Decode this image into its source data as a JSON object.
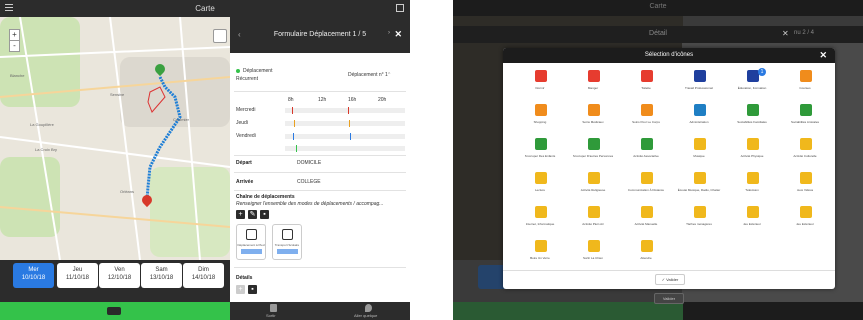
{
  "left": {
    "app_title": "Carte",
    "form": {
      "title": "Formulaire Déplacement 1 / 5",
      "move_label": "Déplacement",
      "recurrent_label": "Récurrent",
      "move_number": "Déplacement n° 1",
      "hours": [
        "8h",
        "12h",
        "16h",
        "20h"
      ],
      "weekdays": [
        "Mercredi",
        "Jeudi",
        "Vendredi"
      ],
      "depart_label": "Départ",
      "depart_value": "DOMICILE",
      "arrivee_label": "Arrivée",
      "arrivee_value": "COLLEGE",
      "chain_title": "Chaîne de déplacements",
      "chain_hint": "Renseigner l'ensemble des modes de déplacements / accompag...",
      "card1_caption": "Déplacement à Pied",
      "card2_caption": "Transport Scolaire",
      "details_label": "Détails"
    },
    "days": [
      {
        "name": "Mer",
        "date": "10/10/18"
      },
      {
        "name": "Jeu",
        "date": "11/10/18"
      },
      {
        "name": "Ven",
        "date": "12/10/18"
      },
      {
        "name": "Sam",
        "date": "13/10/18"
      },
      {
        "name": "Dim",
        "date": "14/10/18"
      }
    ],
    "map_labels": [
      "La Goupillère",
      "Blanche",
      "La Croix Bry",
      "Sensive",
      "Coulmier",
      "Orléans"
    ],
    "bottom": {
      "left": "Sortir",
      "right": "Aller quelque"
    }
  },
  "right": {
    "app_title": "Carte",
    "detail_title": "Détail",
    "detail_page": "nu 2 / 4",
    "modal": {
      "title": "Sélection d'icônes",
      "badge_count": "1",
      "validate_label": "Valider",
      "icons": [
        {
          "label": "Dormir",
          "color": "#e63c2f"
        },
        {
          "label": "Manger",
          "color": "#e63c2f"
        },
        {
          "label": "Toilette",
          "color": "#e63c2f"
        },
        {
          "label": "Travail Professionnel",
          "color": "#1f3f9e"
        },
        {
          "label": "Éducation, Formation",
          "color": "#1f3f9e"
        },
        {
          "label": "Courses",
          "color": "#f08c1c"
        },
        {
          "label": "Shopping",
          "color": "#f08c1c"
        },
        {
          "label": "Soins Médicaux",
          "color": "#f08c1c"
        },
        {
          "label": "Soins Pour Le Corps",
          "color": "#f08c1c"
        },
        {
          "label": "Administration",
          "color": "#1f7fc4"
        },
        {
          "label": "Sociabilités Familiales",
          "color": "#2f9a3a"
        },
        {
          "label": "Sociabilités Amicales",
          "color": "#2f9a3a"
        },
        {
          "label": "S'occuper Des Enfants",
          "color": "#2f9a3a"
        },
        {
          "label": "S'occuper D'autres Personnes",
          "color": "#2f9a3a"
        },
        {
          "label": "Activité Associative",
          "color": "#2f9a3a"
        },
        {
          "label": "Musique",
          "color": "#f0b81c"
        },
        {
          "label": "Activité Physique",
          "color": "#f0b81c"
        },
        {
          "label": "Activité Culturelle",
          "color": "#f0b81c"
        },
        {
          "label": "Lecture",
          "color": "#f0b81c"
        },
        {
          "label": "Activité Religieuse",
          "color": "#f0b81c"
        },
        {
          "label": "Communication À Distance",
          "color": "#f0b81c"
        },
        {
          "label": "Écouté Musique, Radio, Chatter",
          "color": "#f0b81c"
        },
        {
          "label": "Télévision",
          "color": "#f0b81c"
        },
        {
          "label": "Jeux Vidéos",
          "color": "#f0b81c"
        },
        {
          "label": "Internet, Informatique",
          "color": "#f0b81c"
        },
        {
          "label": "Activité Plein Air",
          "color": "#f0b81c"
        },
        {
          "label": "Activité Manuelle",
          "color": "#f0b81c"
        },
        {
          "label": "Tâches ménagères",
          "color": "#f0b81c"
        },
        {
          "label": "Jeu Extérieur",
          "color": "#f0b81c"
        },
        {
          "label": "Jeu Extérieur",
          "color": "#f0b81c"
        },
        {
          "label": "Boire Un Verre",
          "color": "#f0b81c"
        },
        {
          "label": "Sortir La Chien",
          "color": "#f0b81c"
        },
        {
          "label": "Attendre",
          "color": "#f0b81c"
        }
      ]
    },
    "bg_validate_label": "Valider"
  },
  "colors": {
    "accent": "#2a7ae2",
    "green": "#34c24a",
    "dark": "#2c2c2c"
  }
}
